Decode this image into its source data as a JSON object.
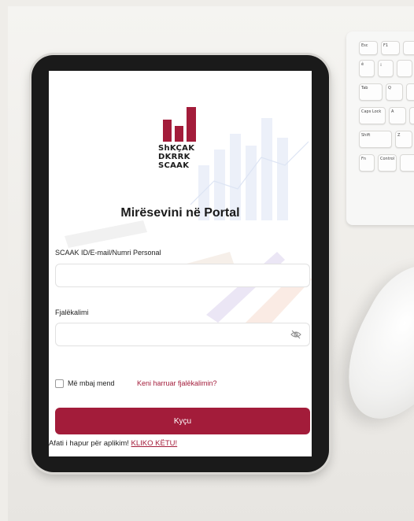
{
  "logo": {
    "line1": "ShKÇAK",
    "line2": "DKRRK",
    "line3": "SCAAK"
  },
  "title": "Mirësevini në Portal",
  "username": {
    "label": "SCAAK ID/E-mail/Numri Personal",
    "value": "",
    "placeholder": ""
  },
  "password": {
    "label": "Fjalëkalimi",
    "value": "",
    "placeholder": ""
  },
  "remember": {
    "label": "Më mbaj mend",
    "checked": false
  },
  "forgot_link": "Keni harruar fjalëkalimin?",
  "login_button": "Kyçu",
  "notice": {
    "text": "Afati i hapur për aplikim! ",
    "link": "KLIKO KËTU!"
  },
  "keyboard": {
    "keys": [
      "Esc",
      "F1",
      "ê",
      "¡",
      "Tab",
      "Q",
      "Caps Lock",
      "A",
      "Shift",
      "Z",
      "Fn",
      "Control"
    ]
  },
  "colors": {
    "brand": "#a31c3a",
    "screen_bg": "#ffffff",
    "desk_bg": "#efede9"
  }
}
